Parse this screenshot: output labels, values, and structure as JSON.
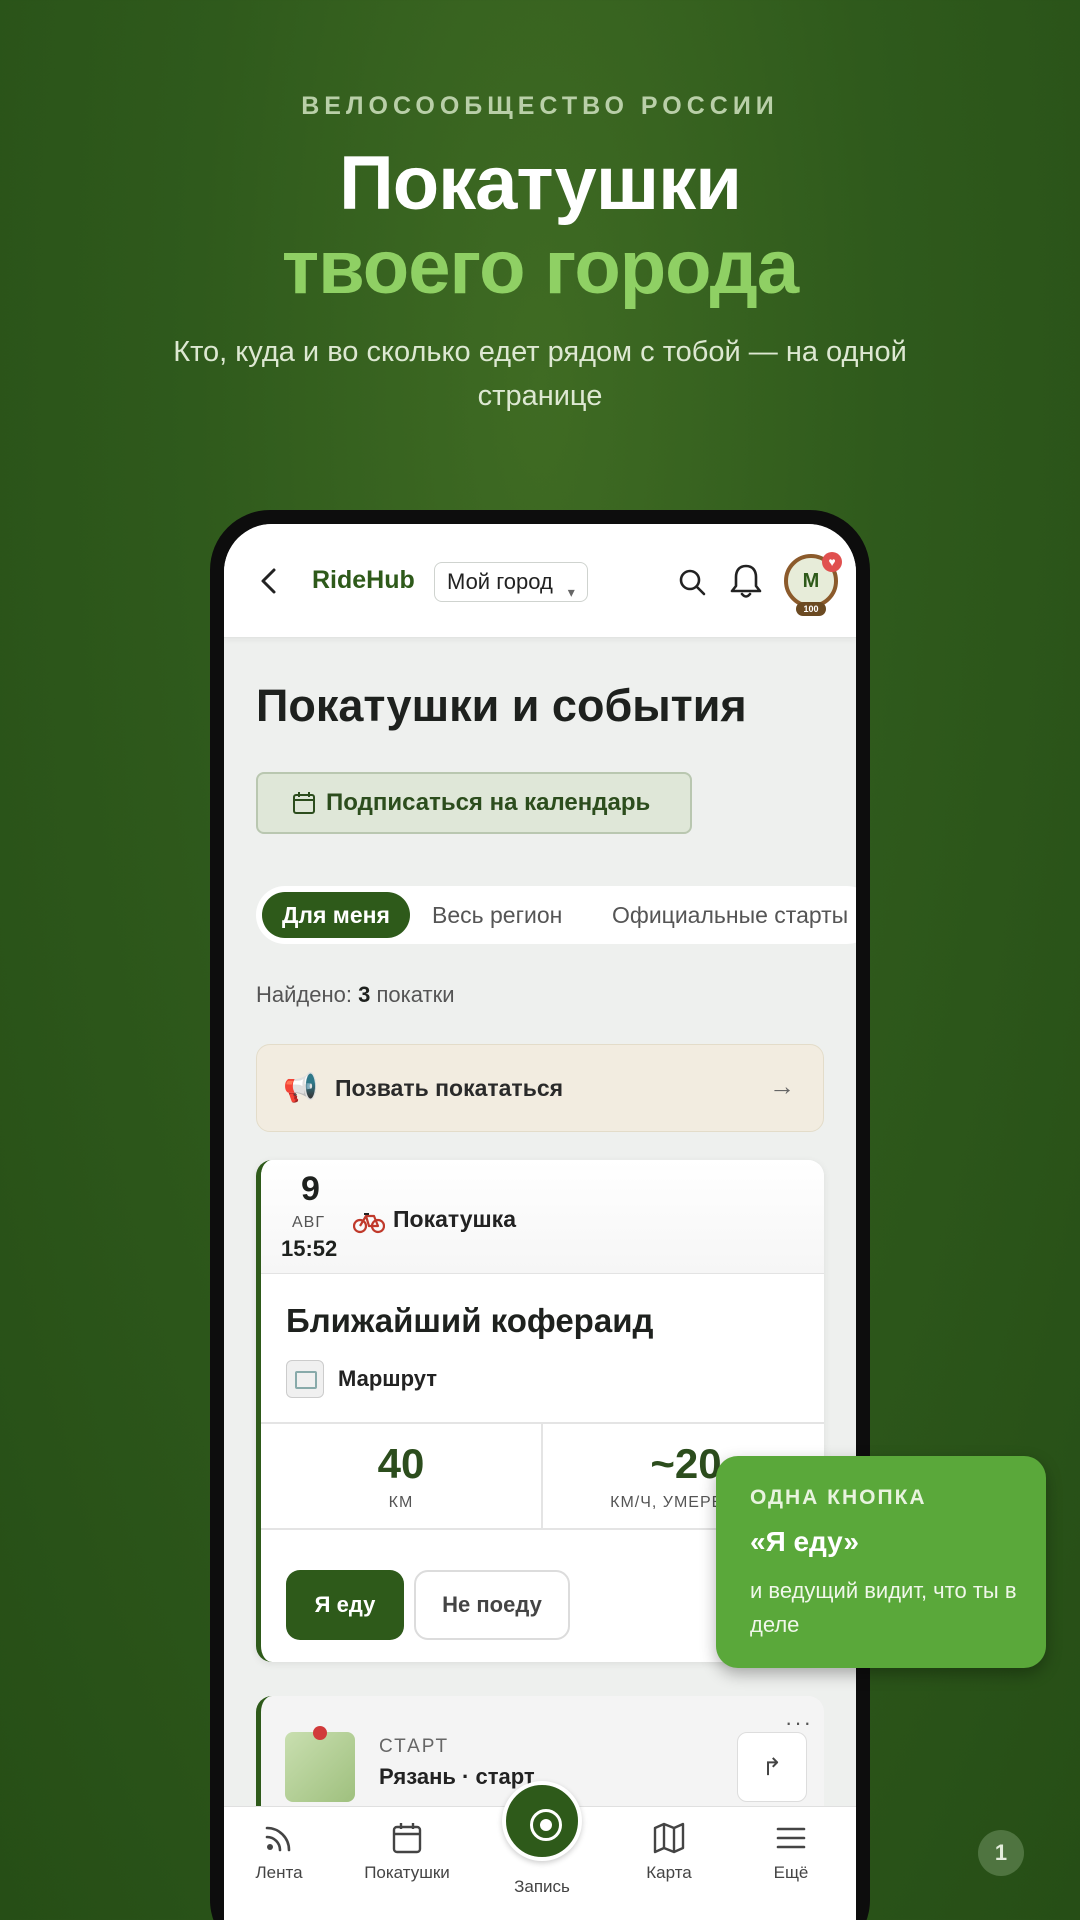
{
  "hero": {
    "eyebrow": "ВЕЛОСООБЩЕСТВО РОССИИ",
    "title_line1": "Покатушки",
    "title_line2": "твоего города",
    "subtitle": "Кто, куда и во сколько едет рядом с тобой — на одной странице"
  },
  "appbar": {
    "brand": "RideHub",
    "city_select": "Мой город",
    "avatar_initial": "М",
    "avatar_badge": "100"
  },
  "page": {
    "title": "Покатушки и события",
    "subscribe_button": "Подписаться на календарь"
  },
  "tabs": [
    {
      "label": "Для меня",
      "active": true
    },
    {
      "label": "Весь регион",
      "active": false
    },
    {
      "label": "Официальные старты",
      "active": false
    }
  ],
  "found": {
    "prefix": "Найдено:",
    "count": "3",
    "suffix": "покатки"
  },
  "invite": {
    "label": "Позвать покататься"
  },
  "event1": {
    "day": "9",
    "month": "АВГ",
    "time": "15:52",
    "type": "Покатушка",
    "title": "Ближайший кофераид",
    "route_label": "Маршрут",
    "stats": [
      {
        "value": "40",
        "label": "КМ"
      },
      {
        "value": "~20",
        "label": "КМ/Ч, УМЕРЕННО"
      }
    ],
    "btn_go": "Я еду",
    "btn_no": "Не поеду"
  },
  "event2": {
    "label": "СТАРТ",
    "value": "Рязань · старт",
    "more": "···"
  },
  "bottomnav": {
    "items": [
      {
        "label": "Лента",
        "icon": "rss-icon"
      },
      {
        "label": "Покатушки",
        "icon": "calendar-icon"
      },
      {
        "label": "Запись",
        "icon": "record-icon"
      },
      {
        "label": "Карта",
        "icon": "map-icon"
      },
      {
        "label": "Ещё",
        "icon": "menu-icon"
      }
    ]
  },
  "callout": {
    "eyebrow": "ОДНА КНОПКА",
    "title": "«Я еду»",
    "text": "и ведущий видит, что ты в деле"
  },
  "page_number": "1",
  "colors": {
    "brand_green": "#2e5a1a",
    "accent_green": "#8fd064",
    "callout_green": "#5aa83a"
  }
}
